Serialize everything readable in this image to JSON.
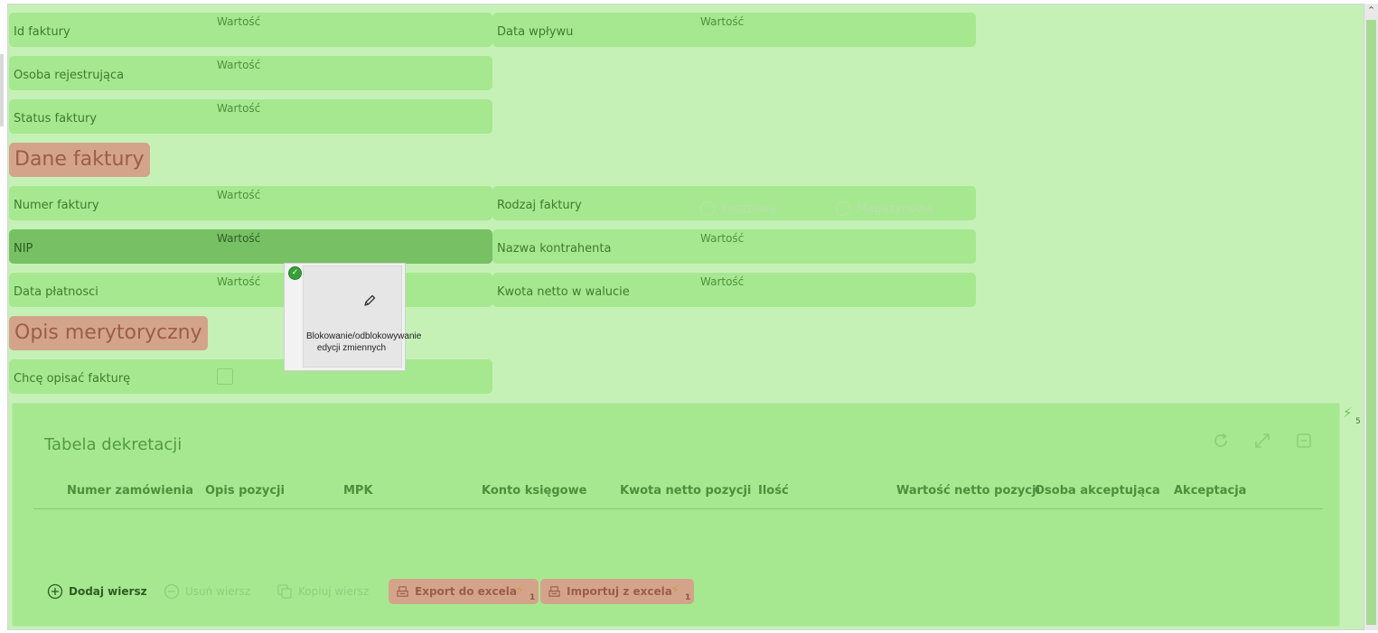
{
  "fields": {
    "id_faktury": {
      "label": "Id faktury",
      "value": "Wartość"
    },
    "data_wplywu": {
      "label": "Data wpływu",
      "value": "Wartość"
    },
    "osoba_rejestrujaca": {
      "label": "Osoba rejestrująca",
      "value": "Wartość"
    },
    "status_faktury": {
      "label": "Status faktury",
      "value": "Wartość"
    },
    "numer_faktury": {
      "label": "Numer faktury",
      "value": "Wartość"
    },
    "rodzaj_faktury": {
      "label": "Rodzaj faktury",
      "options": [
        "Kosztowa",
        "Magazynowa"
      ]
    },
    "nip": {
      "label": "NIP",
      "value": "Wartość"
    },
    "nazwa_kontrahenta": {
      "label": "Nazwa kontrahenta",
      "value": "Wartość"
    },
    "data_platnosci": {
      "label": "Data płatnosci",
      "value": "Wartość"
    },
    "kwota_netto": {
      "label": "Kwota netto w walucie",
      "value": "Wartość"
    },
    "chce_opisac": {
      "label": "Chcę opisać fakturę",
      "checked": false
    }
  },
  "sections": {
    "dane_faktury": "Dane faktury",
    "opis_merytoryczny": "Opis merytoryczny"
  },
  "popup": {
    "text": "Blokowanie/odblokowywanie edycji zmiennych",
    "icon": "pencil-icon"
  },
  "table": {
    "title": "Tabela dekretacji",
    "columns": [
      "Numer zamówienia",
      "Opis pozycji",
      "MPK",
      "Konto księgowe",
      "Kwota netto pozycji",
      "Ilość",
      "Wartość netto pozycji",
      "Osoba akceptująca",
      "Akceptacja"
    ],
    "rows": [],
    "badge_count": "5",
    "buttons": {
      "add": "Dodaj wiersz",
      "remove": "Usuń wiersz",
      "copy": "Kopiuj wiersz",
      "export": "Export do excela",
      "export_badge": "1",
      "import": "Importuj z excela",
      "import_badge": "1"
    }
  },
  "colors": {
    "background": "#c5f1b7",
    "field": "#a6e890",
    "field_selected": "#77c064",
    "section": "#d4a48a"
  }
}
